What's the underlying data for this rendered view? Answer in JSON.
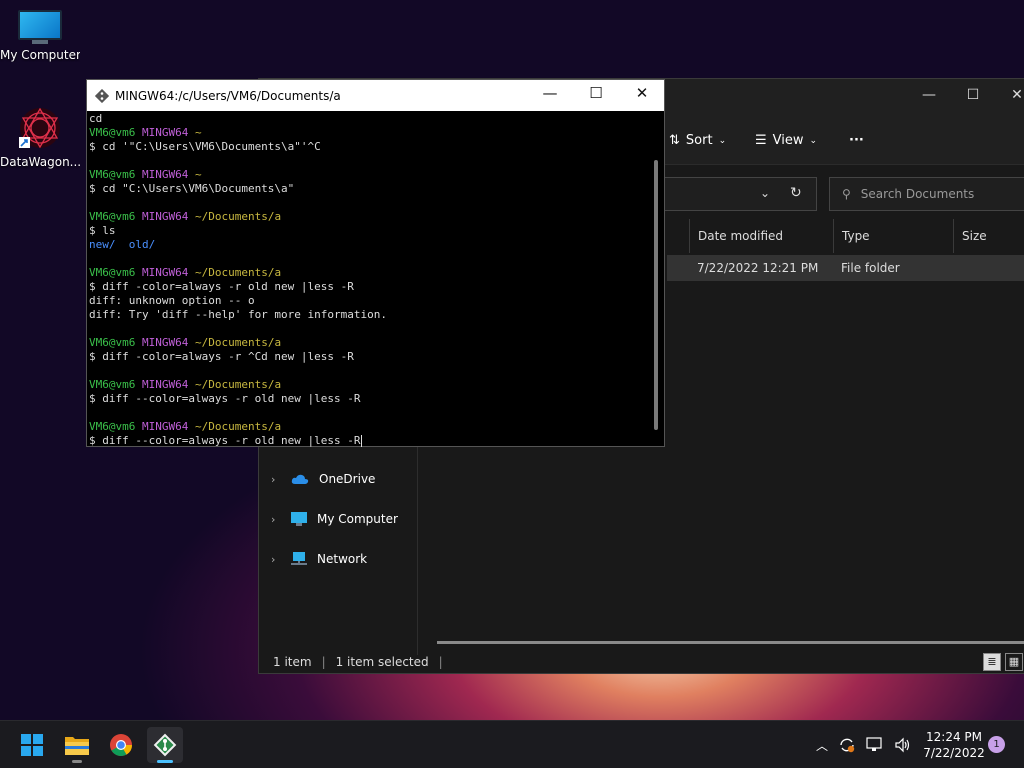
{
  "desktop": {
    "icons": [
      {
        "label": "My Computer",
        "icon": "computer-icon"
      },
      {
        "label": "DataWagon...",
        "icon": "datawagon-icon"
      }
    ]
  },
  "explorer": {
    "toolbar": {
      "sort_label": "Sort",
      "view_label": "View",
      "more_label": "···"
    },
    "search_placeholder": "Search Documents",
    "columns": [
      "Date modified",
      "Type",
      "Size"
    ],
    "row": {
      "date": "7/22/2022 12:21 PM",
      "type": "File folder"
    },
    "nav_items": [
      {
        "label": "OneDrive",
        "icon": "onedrive-icon"
      },
      {
        "label": "My Computer",
        "icon": "computer-icon"
      },
      {
        "label": "Network",
        "icon": "network-icon"
      }
    ],
    "status": {
      "count": "1 item",
      "selected": "1 item selected"
    }
  },
  "terminal": {
    "title": "MINGW64:/c/Users/VM6/Documents/a",
    "lines": [
      {
        "segs": [
          {
            "t": "cd",
            "c": ""
          }
        ]
      },
      {
        "segs": [
          {
            "t": "VM6@vm6 ",
            "c": "t-green"
          },
          {
            "t": "MINGW64 ",
            "c": "t-purple"
          },
          {
            "t": "~",
            "c": "t-yellow"
          }
        ]
      },
      {
        "segs": [
          {
            "t": "$ cd '\"C:\\Users\\VM6\\Documents\\a\"'^C",
            "c": ""
          }
        ]
      },
      {
        "segs": [
          {
            "t": "",
            "c": ""
          }
        ]
      },
      {
        "segs": [
          {
            "t": "VM6@vm6 ",
            "c": "t-green"
          },
          {
            "t": "MINGW64 ",
            "c": "t-purple"
          },
          {
            "t": "~",
            "c": "t-yellow"
          }
        ]
      },
      {
        "segs": [
          {
            "t": "$ cd \"C:\\Users\\VM6\\Documents\\a\"",
            "c": ""
          }
        ]
      },
      {
        "segs": [
          {
            "t": "",
            "c": ""
          }
        ]
      },
      {
        "segs": [
          {
            "t": "VM6@vm6 ",
            "c": "t-green"
          },
          {
            "t": "MINGW64 ",
            "c": "t-purple"
          },
          {
            "t": "~/Documents/a",
            "c": "t-yellow"
          }
        ]
      },
      {
        "segs": [
          {
            "t": "$ ls",
            "c": ""
          }
        ]
      },
      {
        "segs": [
          {
            "t": "new/",
            "c": "t-blue"
          },
          {
            "t": "  ",
            "c": ""
          },
          {
            "t": "old/",
            "c": "t-blue"
          }
        ]
      },
      {
        "segs": [
          {
            "t": "",
            "c": ""
          }
        ]
      },
      {
        "segs": [
          {
            "t": "VM6@vm6 ",
            "c": "t-green"
          },
          {
            "t": "MINGW64 ",
            "c": "t-purple"
          },
          {
            "t": "~/Documents/a",
            "c": "t-yellow"
          }
        ]
      },
      {
        "segs": [
          {
            "t": "$ diff -color=always -r old new |less -R",
            "c": ""
          }
        ]
      },
      {
        "segs": [
          {
            "t": "diff: unknown option -- o",
            "c": ""
          }
        ]
      },
      {
        "segs": [
          {
            "t": "diff: Try 'diff --help' for more information.",
            "c": ""
          }
        ]
      },
      {
        "segs": [
          {
            "t": "",
            "c": ""
          }
        ]
      },
      {
        "segs": [
          {
            "t": "VM6@vm6 ",
            "c": "t-green"
          },
          {
            "t": "MINGW64 ",
            "c": "t-purple"
          },
          {
            "t": "~/Documents/a",
            "c": "t-yellow"
          }
        ]
      },
      {
        "segs": [
          {
            "t": "$ diff -color=always -r ^Cd new |less -R",
            "c": ""
          }
        ]
      },
      {
        "segs": [
          {
            "t": "",
            "c": ""
          }
        ]
      },
      {
        "segs": [
          {
            "t": "VM6@vm6 ",
            "c": "t-green"
          },
          {
            "t": "MINGW64 ",
            "c": "t-purple"
          },
          {
            "t": "~/Documents/a",
            "c": "t-yellow"
          }
        ]
      },
      {
        "segs": [
          {
            "t": "$ diff --color=always -r old new |less -R",
            "c": ""
          }
        ]
      },
      {
        "segs": [
          {
            "t": "",
            "c": ""
          }
        ]
      },
      {
        "segs": [
          {
            "t": "VM6@vm6 ",
            "c": "t-green"
          },
          {
            "t": "MINGW64 ",
            "c": "t-purple"
          },
          {
            "t": "~/Documents/a",
            "c": "t-yellow"
          }
        ]
      },
      {
        "segs": [
          {
            "t": "$ diff --color=always -r old new |less -R",
            "c": ""
          }
        ],
        "cursor": true
      }
    ]
  },
  "taskbar": {
    "apps": [
      {
        "name": "start-button",
        "icon": "windows-logo-icon"
      },
      {
        "name": "file-explorer-app",
        "icon": "folder-icon"
      },
      {
        "name": "chrome-app",
        "icon": "chrome-icon"
      },
      {
        "name": "git-bash-app",
        "icon": "git-icon"
      }
    ],
    "time": "12:24 PM",
    "date": "7/22/2022",
    "notifications": "1"
  }
}
